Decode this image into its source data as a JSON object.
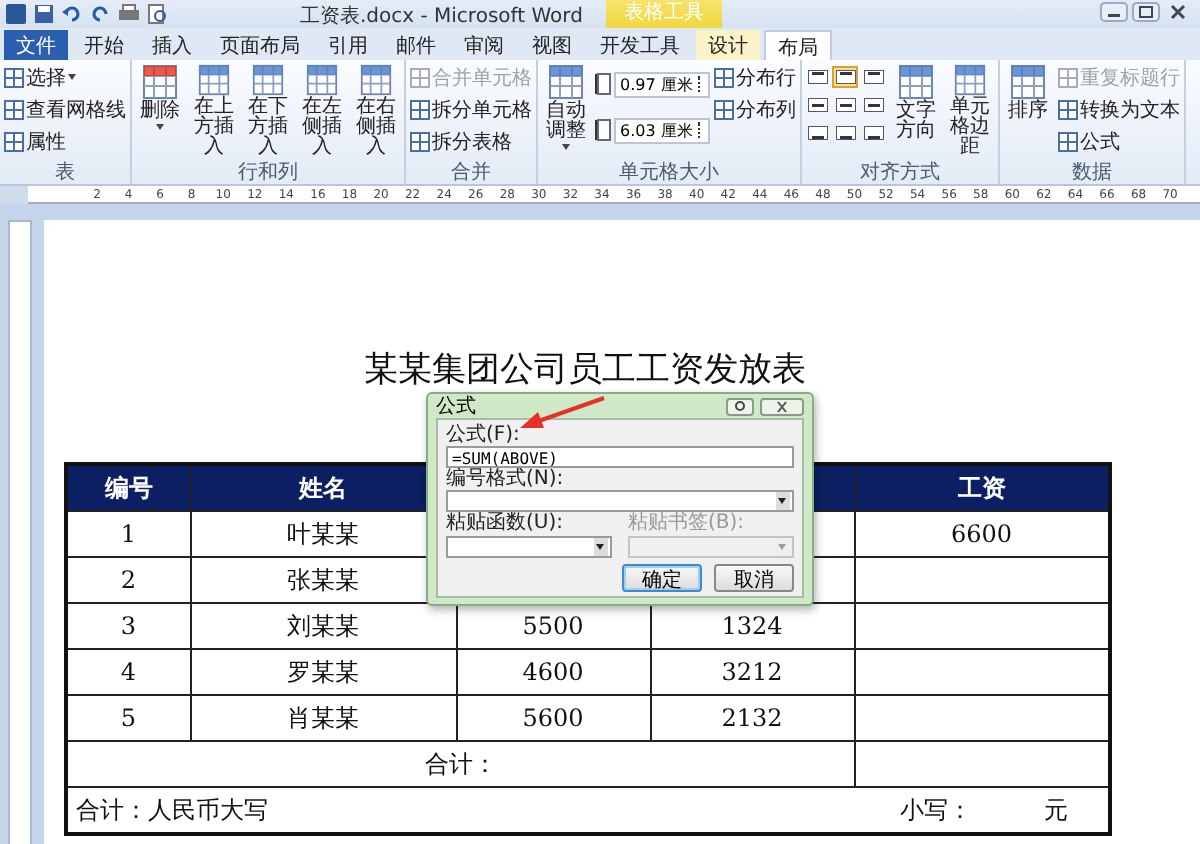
{
  "window": {
    "title": "工资表.docx - Microsoft Word"
  },
  "contextual_group": "表格工具",
  "tabs": [
    {
      "label": "文件",
      "selected": false,
      "kind": "file"
    },
    {
      "label": "开始",
      "selected": false,
      "kind": "plain"
    },
    {
      "label": "插入",
      "selected": false,
      "kind": "plain"
    },
    {
      "label": "页面布局",
      "selected": false,
      "kind": "plain"
    },
    {
      "label": "引用",
      "selected": false,
      "kind": "plain"
    },
    {
      "label": "邮件",
      "selected": false,
      "kind": "plain"
    },
    {
      "label": "审阅",
      "selected": false,
      "kind": "plain"
    },
    {
      "label": "视图",
      "selected": false,
      "kind": "plain"
    },
    {
      "label": "开发工具",
      "selected": false,
      "kind": "plain"
    },
    {
      "label": "设计",
      "selected": false,
      "kind": "tool"
    },
    {
      "label": "布局",
      "selected": true,
      "kind": "tool"
    }
  ],
  "ribbon_groups": [
    {
      "title": "表",
      "items": [
        {
          "kind": "small",
          "label": "选择",
          "dropdown": true,
          "disabled": false
        },
        {
          "kind": "small",
          "label": "查看网格线",
          "dropdown": false,
          "disabled": false
        },
        {
          "kind": "small",
          "label": "属性",
          "dropdown": false,
          "disabled": false
        }
      ]
    },
    {
      "title": "行和列",
      "items": [
        {
          "kind": "large",
          "label": "删除",
          "dropdown": true,
          "disabled": false
        },
        {
          "kind": "large",
          "label": "在上方插入",
          "dropdown": false,
          "disabled": false
        },
        {
          "kind": "large",
          "label": "在下方插入",
          "dropdown": false,
          "disabled": false
        },
        {
          "kind": "large",
          "label": "在左侧插入",
          "dropdown": false,
          "disabled": false
        },
        {
          "kind": "large",
          "label": "在右侧插入",
          "dropdown": false,
          "disabled": false
        }
      ]
    },
    {
      "title": "合并",
      "items": [
        {
          "kind": "small",
          "label": "合并单元格",
          "dropdown": false,
          "disabled": true
        },
        {
          "kind": "small",
          "label": "拆分单元格",
          "dropdown": false,
          "disabled": false
        },
        {
          "kind": "small",
          "label": "拆分表格",
          "dropdown": false,
          "disabled": false
        }
      ]
    },
    {
      "title": "单元格大小",
      "items": [
        {
          "kind": "large",
          "label": "自动调整",
          "dropdown": true,
          "disabled": false
        },
        {
          "kind": "spin",
          "value": "0.97 厘米"
        },
        {
          "kind": "spin",
          "value": "6.03 厘米"
        },
        {
          "kind": "small",
          "label": "分布行",
          "dropdown": false,
          "disabled": false
        },
        {
          "kind": "small",
          "label": "分布列",
          "dropdown": false,
          "disabled": false
        }
      ]
    },
    {
      "title": "对齐方式",
      "items": [
        {
          "kind": "align",
          "cells": [
            {
              "selected": false
            },
            {
              "selected": true
            },
            {
              "selected": false
            },
            {
              "selected": false
            },
            {
              "selected": false
            },
            {
              "selected": false
            },
            {
              "selected": false
            },
            {
              "selected": false
            },
            {
              "selected": false
            }
          ]
        },
        {
          "kind": "large",
          "label": "文字方向",
          "dropdown": false,
          "disabled": false
        },
        {
          "kind": "large",
          "label": "单元格边距",
          "dropdown": false,
          "disabled": false
        }
      ]
    },
    {
      "title": "数据",
      "items": [
        {
          "kind": "large",
          "label": "排序",
          "dropdown": false,
          "disabled": false
        },
        {
          "kind": "small",
          "label": "重复标题行",
          "dropdown": false,
          "disabled": true
        },
        {
          "kind": "small",
          "label": "转换为文本",
          "dropdown": false,
          "disabled": false
        },
        {
          "kind": "small",
          "label": "公式",
          "dropdown": false,
          "disabled": false
        }
      ]
    }
  ],
  "ruler_numbers": [
    "2",
    "4",
    "6",
    "8",
    "10",
    "12",
    "14",
    "16",
    "18",
    "20",
    "22",
    "24",
    "26",
    "28",
    "30",
    "32",
    "34",
    "36",
    "38",
    "40",
    "42",
    "44",
    "46",
    "48",
    "50",
    "52",
    "54",
    "56",
    "58",
    "60",
    "62",
    "64",
    "66",
    "68",
    "70"
  ],
  "document": {
    "title": "某某集团公司员工工资发放表",
    "header": {
      "number": "编号",
      "name": "姓名",
      "salary": "工资"
    },
    "rows": [
      {
        "number": "1",
        "name": "叶某某",
        "salary": "6600"
      },
      {
        "number": "2",
        "name": "张某某"
      },
      {
        "number": "3",
        "name": "刘某某",
        "column_3": "5500",
        "column_4": "1324"
      },
      {
        "number": "4",
        "name": "罗某某",
        "column_3": "4600",
        "column_4": "3212"
      },
      {
        "number": "5",
        "name": "肖某某",
        "column_3": "5600",
        "column_4": "2132"
      }
    ],
    "total_label": "合计：",
    "amount_row": {
      "label": "合计：人民币大写",
      "small_label": "小写：",
      "unit": "元"
    }
  },
  "dialog": {
    "title": "公式",
    "fields": [
      {
        "kind": "text",
        "label": "公式(F):",
        "value": "=SUM(ABOVE)"
      },
      {
        "kind": "combo",
        "label": "编号格式(N):"
      },
      {
        "kind": "select",
        "label": "粘贴函数(U):",
        "disabled": false
      },
      {
        "kind": "select",
        "label": "粘贴书签(B):",
        "disabled": true
      }
    ],
    "buttons": [
      {
        "label": "确定",
        "default": true
      },
      {
        "label": "取消",
        "default": false
      }
    ]
  }
}
